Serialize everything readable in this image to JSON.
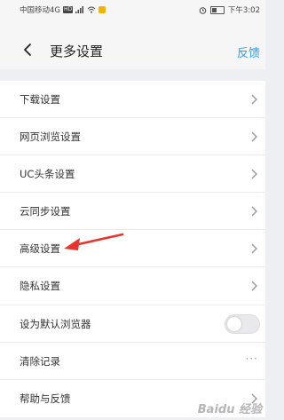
{
  "status_bar": {
    "carrier": "中国移动4G",
    "hd": "HD",
    "time": "下午3:02"
  },
  "header": {
    "title": "更多设置",
    "feedback": "反馈"
  },
  "settings": [
    {
      "label": "下载设置"
    },
    {
      "label": "网页浏览设置"
    },
    {
      "label": "UC头条设置"
    },
    {
      "label": "云同步设置"
    },
    {
      "label": "高级设置"
    },
    {
      "label": "隐私设置"
    }
  ],
  "default_browser": {
    "label": "设为默认浏览器",
    "enabled": false
  },
  "clear_history": {
    "label": "清除记录",
    "more": "···"
  },
  "help": {
    "label": "帮助与反馈"
  },
  "watermark": "Baidu 经验",
  "colors": {
    "accent": "#2a9df4",
    "annotation_arrow": "#e8342c"
  }
}
